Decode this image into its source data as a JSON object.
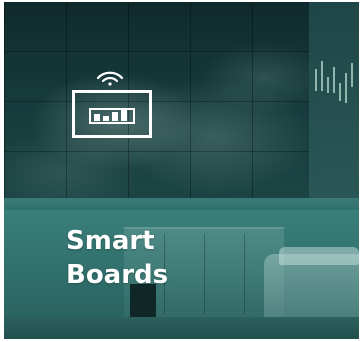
{
  "tile": {
    "title_line1": "Smart",
    "title_line2": "Boards",
    "icon": "smart-board-chart-icon",
    "accent": "#2f6d6a"
  }
}
